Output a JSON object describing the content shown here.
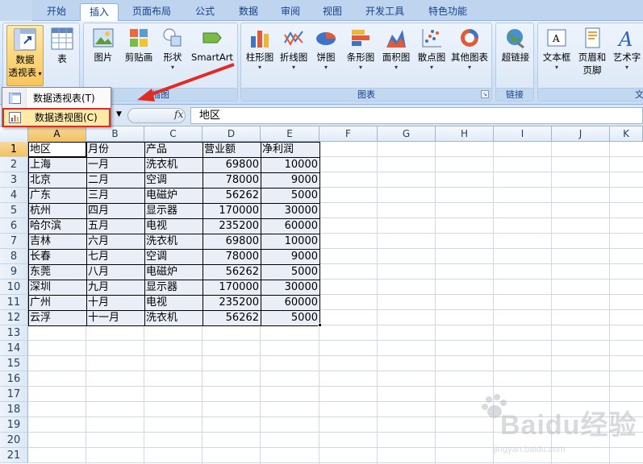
{
  "tabs": [
    "开始",
    "插入",
    "页面布局",
    "公式",
    "数据",
    "审阅",
    "视图",
    "开发工具",
    "特色功能"
  ],
  "active_tab_index": 1,
  "ribbon": {
    "groups": {
      "tables": {
        "title": ""
      },
      "illustrations": {
        "title": "插图"
      },
      "charts": {
        "title": "图表"
      },
      "links": {
        "title": "链接"
      },
      "text": {
        "title": "文"
      }
    },
    "buttons": {
      "pivot_line1": "数据",
      "pivot_line2": "透视表",
      "table": "表",
      "picture": "图片",
      "clipart": "剪贴画",
      "shapes": "形状",
      "smartart": "SmartArt",
      "column": "柱形图",
      "line": "折线图",
      "pie": "饼图",
      "bar": "条形图",
      "area": "面积图",
      "scatter": "散点图",
      "other": "其他图表",
      "hyperlink": "超链接",
      "textbox": "文本框",
      "header_line1": "页眉和",
      "header_line2": "页脚",
      "wordart": "艺术字"
    }
  },
  "dropdown_menu": {
    "items": [
      "数据透视表(T)",
      "数据透视图(C)"
    ],
    "highlighted_index": 1
  },
  "formula_bar": {
    "fx_label": "fx",
    "value": "地区"
  },
  "columns": [
    "A",
    "B",
    "C",
    "D",
    "E",
    "F",
    "G",
    "H",
    "I",
    "J",
    "K"
  ],
  "selected_column": "A",
  "rows": [
    "1",
    "2",
    "3",
    "4",
    "5",
    "6",
    "7",
    "8",
    "9",
    "10",
    "11",
    "12",
    "13",
    "14",
    "15",
    "16",
    "17",
    "18",
    "19",
    "20",
    "21"
  ],
  "selected_row": "1",
  "table": {
    "header": [
      "地区",
      "月份",
      "产品",
      "营业额",
      "净利润"
    ],
    "rows": [
      [
        "上海",
        "一月",
        "洗衣机",
        "69800",
        "10000"
      ],
      [
        "北京",
        "二月",
        "空调",
        "78000",
        "9000"
      ],
      [
        "广东",
        "三月",
        "电磁炉",
        "56262",
        "5000"
      ],
      [
        "杭州",
        "四月",
        "显示器",
        "170000",
        "30000"
      ],
      [
        "哈尔滨",
        "五月",
        "电视",
        "235200",
        "60000"
      ],
      [
        "吉林",
        "六月",
        "洗衣机",
        "69800",
        "10000"
      ],
      [
        "长春",
        "七月",
        "空调",
        "78000",
        "9000"
      ],
      [
        "东莞",
        "八月",
        "电磁炉",
        "56262",
        "5000"
      ],
      [
        "深圳",
        "九月",
        "显示器",
        "170000",
        "30000"
      ],
      [
        "广州",
        "十月",
        "电视",
        "235200",
        "60000"
      ],
      [
        "云浮",
        "十一月",
        "洗衣机",
        "56262",
        "5000"
      ]
    ]
  },
  "watermark": {
    "logo": "Baidu经验",
    "sub": "jingyan.baidu.com"
  },
  "colors": {
    "highlight_border": "#e12b25",
    "arrow": "#e12b25",
    "selected_header": "#f1c15f"
  }
}
